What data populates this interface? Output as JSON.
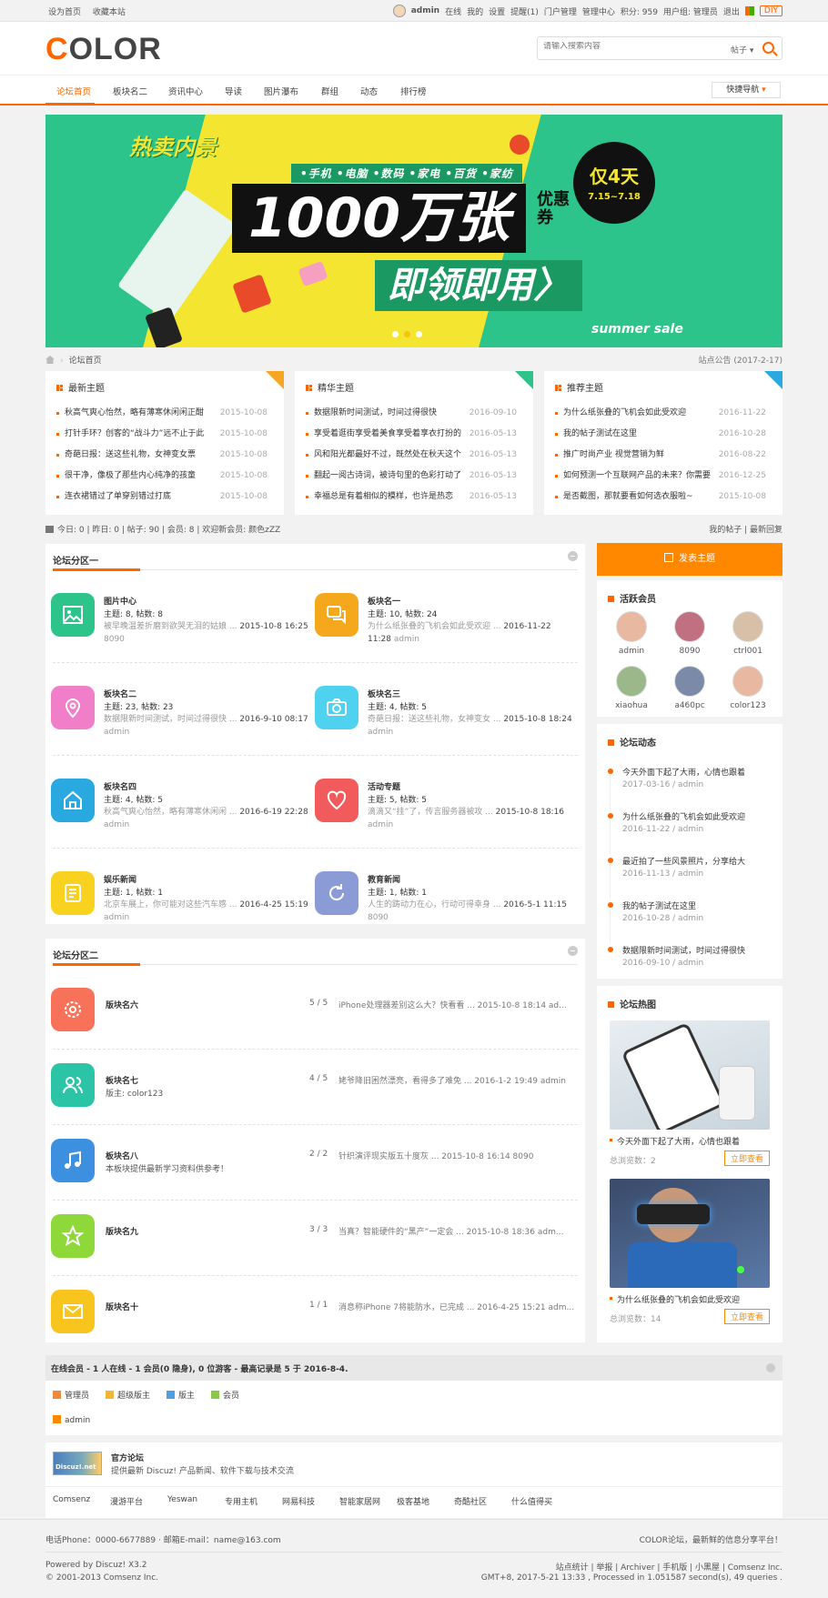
{
  "topbar": {
    "left": [
      "设为首页",
      "收藏本站"
    ],
    "username": "admin",
    "items": [
      "在线",
      "我的",
      "设置",
      "提醒(1)",
      "门户管理",
      "管理中心",
      "积分: 959",
      "用户组: 管理员",
      "退出"
    ],
    "diy": "DIY"
  },
  "header": {
    "logo_first": "C",
    "logo_rest": "OLOR",
    "search_placeholder": "请输入搜索内容",
    "search_type": "帖子"
  },
  "nav": {
    "items": [
      "论坛首页",
      "板块名二",
      "资讯中心",
      "导读",
      "图片瀑布",
      "群组",
      "动态",
      "排行榜"
    ],
    "quick": "快捷导航"
  },
  "banner": {
    "label": "热卖内景",
    "cats": "•手机 •电脑 •数码 •家电 •百货 •家纺",
    "main": "1000万张",
    "coupon": "优惠券",
    "days": "仅4天",
    "dates": "7.15~7.18",
    "cta": "即领即用〉",
    "summer": "summer sale"
  },
  "crumb": {
    "home": "论坛首页",
    "notice": "站点公告 (2017-2-17)"
  },
  "boxes": [
    {
      "title": "最新主题",
      "color": "#f6a623",
      "items": [
        {
          "t": "秋高气爽心怡然，略有薄寒休闲闲正酣",
          "d": "2015-10-08"
        },
        {
          "t": "打针手环？创客的“战斗力”远不止于此",
          "d": "2015-10-08"
        },
        {
          "t": "奇葩日报：送这些礼物，女神变女票",
          "d": "2015-10-08"
        },
        {
          "t": "很干净，像极了那些内心纯净的孩童",
          "d": "2015-10-08"
        },
        {
          "t": "连衣裙错过了单穿别错过打底",
          "d": "2015-10-08"
        }
      ]
    },
    {
      "title": "精华主题",
      "color": "#2cc48a",
      "items": [
        {
          "t": "数据限新时间测试，时间过得很快",
          "d": "2016-09-10"
        },
        {
          "t": "享受着逛街享受着美食享受着享衣打扮的",
          "d": "2016-05-13"
        },
        {
          "t": "风和阳光都最好不过，既然处在秋天这个",
          "d": "2016-05-13"
        },
        {
          "t": "翻起一阅古诗词，被诗句里的色彩打动了",
          "d": "2016-05-13"
        },
        {
          "t": "幸福总是有着相似的模样，也许是热恋",
          "d": "2016-05-13"
        }
      ]
    },
    {
      "title": "推荐主题",
      "color": "#2aa8e0",
      "items": [
        {
          "t": "为什么纸张叠的飞机会如此受欢迎",
          "d": "2016-11-22"
        },
        {
          "t": "我的帖子测试在这里",
          "d": "2016-10-28"
        },
        {
          "t": "推广时尚产业 视觉营销为鲜",
          "d": "2016-08-22"
        },
        {
          "t": "如何预测一个互联网产品的未来？你需要",
          "d": "2016-12-25"
        },
        {
          "t": "是否截图，那就要看如何选衣服啦~",
          "d": "2015-10-08"
        }
      ]
    }
  ],
  "stats": {
    "text": "今日: 0 | 昨日: 0 | 帖子: 90 | 会员: 8 | 欢迎新会员: 颜色zZZ",
    "right": "我的帖子 | 最新回复"
  },
  "section1": {
    "title": "论坛分区一",
    "forums": [
      {
        "name": "图片中心",
        "stat": "主题: 8, 帖数: 8",
        "last": "被早晚温差折磨到欲哭无泪的姑娘 ...",
        "time": "2015-10-8 16:25",
        "user": "8090",
        "color": "#2cc48a",
        "icon": "image-icon"
      },
      {
        "name": "板块名一",
        "stat": "主题: 10, 帖数: 24",
        "last": "为什么纸张叠的飞机会如此受欢迎 ...",
        "time": "2016-11-22 11:28",
        "user": "admin",
        "color": "#f6a81c",
        "icon": "chat-icon"
      },
      {
        "name": "板块名二",
        "stat": "主题: 23, 帖数: 23",
        "last": "数据限新时间测试，时间过得很快 ...",
        "time": "2016-9-10 08:17",
        "user": "admin",
        "color": "#f07ec9",
        "icon": "location-icon"
      },
      {
        "name": "板块名三",
        "stat": "主题: 4, 帖数: 5",
        "last": "奇葩日报：送这些礼物，女神变女 ...",
        "time": "2015-10-8 18:24",
        "user": "admin",
        "color": "#4fd2f0",
        "icon": "camera-icon"
      },
      {
        "name": "板块名四",
        "stat": "主题: 4, 帖数: 5",
        "last": "秋高气爽心怡然，略有薄寒休闲闲 ...",
        "time": "2016-6-19 22:28",
        "user": "admin",
        "color": "#2aa8e0",
        "icon": "home-icon"
      },
      {
        "name": "活动专题",
        "stat": "主题: 5, 帖数: 5",
        "last": "滴滴又“挂”了，传言服务器被攻 ...",
        "time": "2015-10-8 18:16",
        "user": "admin",
        "color": "#f25b5b",
        "icon": "heart-icon"
      },
      {
        "name": "娱乐新闻",
        "stat": "主题: 1, 帖数: 1",
        "last": "北京车展上，你可能对这些汽车感 ...",
        "time": "2016-4-25 15:19",
        "user": "admin",
        "color": "#f8d21e",
        "icon": "document-icon"
      },
      {
        "name": "教育新闻",
        "stat": "主题: 1, 帖数: 1",
        "last": "人生的踌动力在心，行动可得幸身 ...",
        "time": "2016-5-1 11:15",
        "user": "8090",
        "color": "#8b9bd6",
        "icon": "refresh-icon"
      }
    ]
  },
  "section2": {
    "title": "论坛分区二",
    "forums": [
      {
        "name": "版块名六",
        "mod": "",
        "count": "5 / 5",
        "last": "iPhone处理器差别这么大？快看看 ... 2015-10-8 18:14 ad...",
        "color": "#f8725a",
        "icon": "gear-icon"
      },
      {
        "name": "板块名七",
        "mod": "版主: color123",
        "count": "4 / 5",
        "last": "姥爷降旧困然漂亮，看得多了难免 ... 2016-1-2 19:49 admin",
        "color": "#2cc4a6",
        "icon": "users-icon"
      },
      {
        "name": "板块名八",
        "mod": "本板块提供最新学习资料供参考！",
        "count": "2 / 2",
        "last": "针织演评现实版五十度灰 ... 2015-10-8 16:14 8090",
        "color": "#3d8fe0",
        "icon": "music-icon"
      },
      {
        "name": "版块名九",
        "mod": "",
        "count": "3 / 3",
        "last": "当真？智能硬件的“黑产”一定会 ... 2015-10-8 18:36 adm...",
        "color": "#8fd83a",
        "icon": "star-icon"
      },
      {
        "name": "版块名十",
        "mod": "",
        "count": "1 / 1",
        "last": "消息称iPhone 7将能防水，已完成 ... 2016-4-25 15:21 adm...",
        "color": "#f8c41e",
        "icon": "mail-icon"
      }
    ]
  },
  "sidebar": {
    "post": "发表主题",
    "members_title": "活跃会员",
    "members": [
      {
        "n": "admin",
        "c": "#e8b8a0"
      },
      {
        "n": "8090",
        "c": "#c07080"
      },
      {
        "n": "ctrl001",
        "c": "#d8c0a8"
      },
      {
        "n": "xiaohua",
        "c": "#9ab88a"
      },
      {
        "n": "a460pc",
        "c": "#7a8aa8"
      },
      {
        "n": "color123",
        "c": "#e8b8a0"
      }
    ],
    "activity_title": "论坛动态",
    "activity": [
      {
        "t": "今天外面下起了大雨，心情也跟着",
        "m": "2017-03-16 / admin"
      },
      {
        "t": "为什么纸张叠的飞机会如此受欢迎",
        "m": "2016-11-22 / admin"
      },
      {
        "t": "最近拍了一些风景照片，分享给大",
        "m": "2016-11-13 / admin"
      },
      {
        "t": "我的帖子测试在这里",
        "m": "2016-10-28 / admin"
      },
      {
        "t": "数据限新时间测试，时间过得很快",
        "m": "2016-09-10 / admin"
      }
    ],
    "hot_title": "论坛热图",
    "hot": [
      {
        "t": "今天外面下起了大雨，心情也跟着",
        "r": "总浏览数：2",
        "b": "立即查看"
      },
      {
        "t": "为什么纸张叠的飞机会如此受欢迎",
        "r": "总浏览数：14",
        "b": "立即查看"
      }
    ]
  },
  "online": {
    "header": "在线会员 - 1 人在线 - 1 会员(0 隐身), 0 位游客 - 最高记录是 5 于 2016-8-4.",
    "legend": [
      {
        "n": "管理员",
        "c": "#f08a3a"
      },
      {
        "n": "超级版主",
        "c": "#f4b63a"
      },
      {
        "n": "版主",
        "c": "#4aa0e0"
      },
      {
        "n": "会员",
        "c": "#8ac84a"
      }
    ],
    "user": "admin"
  },
  "links": {
    "logo": "Discuz!.net",
    "name": "官方论坛",
    "desc": "提供最新 Discuz! 产品新闻、软件下载与技术交流",
    "list": [
      "Comsenz",
      "漫游平台",
      "Yeswan",
      "专用主机",
      "网易科技",
      "智能家居网",
      "极客基地",
      "奇酷社区",
      "什么值得买"
    ]
  },
  "footer": {
    "contact": "电话Phone：0000-6677889  ·  邮箱E-mail：name@163.com",
    "slogan": "COLOR论坛，最新鲜的信息分享平台！",
    "powered": "Powered by Discuz! X3.2",
    "copyright": "© 2001-2013 Comsenz Inc.",
    "links": "站点统计 | 举报 | Archiver | 手机版 | 小黑屋 | Comsenz Inc.",
    "gmt": "GMT+8, 2017-5-21 13:33 , Processed in 1.051587 second(s), 49 queries ."
  }
}
